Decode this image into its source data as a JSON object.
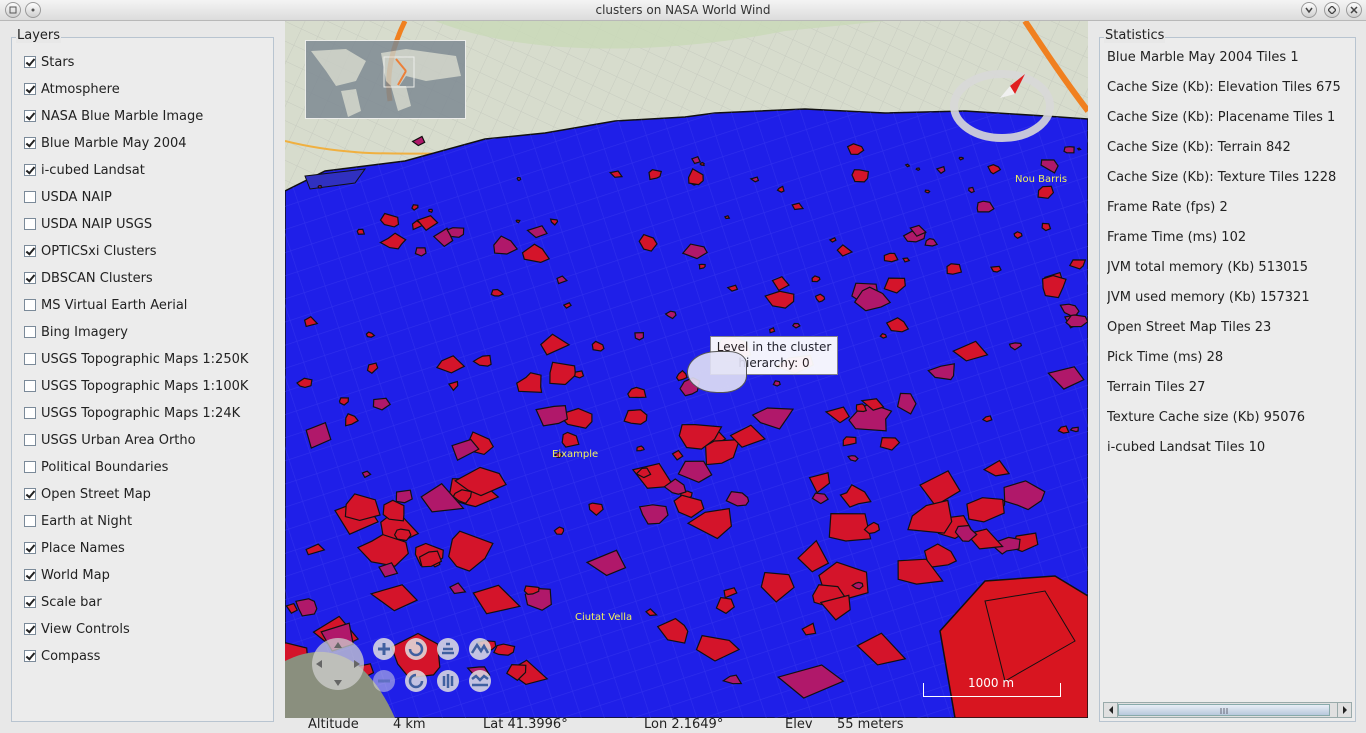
{
  "window": {
    "title": "clusters on NASA World Wind"
  },
  "layers": {
    "title": "Layers",
    "items": [
      {
        "label": "Stars",
        "checked": true
      },
      {
        "label": "Atmosphere",
        "checked": true
      },
      {
        "label": "NASA Blue Marble Image",
        "checked": true
      },
      {
        "label": "Blue Marble May 2004",
        "checked": true
      },
      {
        "label": "i-cubed Landsat",
        "checked": true
      },
      {
        "label": "USDA NAIP",
        "checked": false
      },
      {
        "label": "USDA NAIP USGS",
        "checked": false
      },
      {
        "label": "OPTICSxi Clusters",
        "checked": true
      },
      {
        "label": "DBSCAN Clusters",
        "checked": true
      },
      {
        "label": "MS Virtual Earth Aerial",
        "checked": false
      },
      {
        "label": "Bing Imagery",
        "checked": false
      },
      {
        "label": "USGS Topographic Maps 1:250K",
        "checked": false
      },
      {
        "label": "USGS Topographic Maps 1:100K",
        "checked": false
      },
      {
        "label": "USGS Topographic Maps 1:24K",
        "checked": false
      },
      {
        "label": "USGS Urban Area Ortho",
        "checked": false
      },
      {
        "label": "Political Boundaries",
        "checked": false
      },
      {
        "label": "Open Street Map",
        "checked": true
      },
      {
        "label": "Earth at Night",
        "checked": false
      },
      {
        "label": "Place Names",
        "checked": true
      },
      {
        "label": "World Map",
        "checked": true
      },
      {
        "label": "Scale bar",
        "checked": true
      },
      {
        "label": "View Controls",
        "checked": true
      },
      {
        "label": "Compass",
        "checked": true
      }
    ]
  },
  "statistics": {
    "title": "Statistics",
    "items": [
      "Blue Marble May 2004 Tiles 1",
      "Cache Size (Kb): Elevation Tiles 675",
      "Cache Size (Kb): Placename Tiles 1",
      "Cache Size (Kb): Terrain 842",
      "Cache Size (Kb): Texture Tiles 1228",
      "Frame Rate (fps) 2",
      "Frame Time (ms) 102",
      "JVM total memory (Kb) 513015",
      "JVM used memory (Kb) 157321",
      "Open Street Map Tiles 23",
      "Pick Time (ms) 28",
      "Terrain Tiles 27",
      "Texture Cache size (Kb) 95076",
      "i-cubed Landsat Tiles 10"
    ]
  },
  "map": {
    "tooltip_line1": "Level in the cluster",
    "tooltip_line2": "hierarchy: 0",
    "place_labels": [
      "Nou Barris",
      "Eixample",
      "Ciutat Vella"
    ],
    "scale_label": "1000 m"
  },
  "status": {
    "altitude_label": "Altitude",
    "altitude_value": "4 km",
    "lat": "Lat 41.3996°",
    "lon": "Lon  2.1649°",
    "elev_label": "Elev",
    "elev_value": "55 meters"
  },
  "colors": {
    "water_cluster": "#1f1fe8",
    "cluster_fill": "#d4142a",
    "land": "#d6dccd"
  }
}
